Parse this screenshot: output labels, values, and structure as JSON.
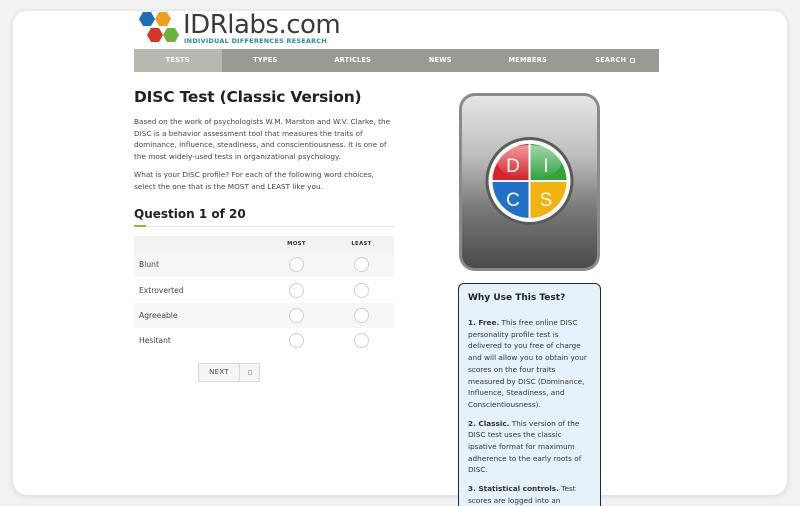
{
  "logo": {
    "word": "IDRlabs.com",
    "tagline": "INDIVIDUAL DIFFERENCES RESEARCH",
    "hex_colors": [
      "#1f6fb5",
      "#f0a020",
      "#d8342a",
      "#6ab23c"
    ]
  },
  "nav": {
    "items": [
      {
        "label": "TESTS",
        "active": true
      },
      {
        "label": "TYPES"
      },
      {
        "label": "ARTICLES"
      },
      {
        "label": "NEWS"
      },
      {
        "label": "MEMBERS"
      },
      {
        "label": "SEARCH",
        "icon": "search-icon"
      }
    ]
  },
  "page": {
    "title": "DISC Test (Classic Version)",
    "intro_1": "Based on the work of psychologists W.M. Marston and W.V. Clarke, the DISC is a behavior assessment tool that measures the traits of dominance, influence, steadiness, and conscientiousness. It is one of the most widely-used tests in organizational psychology.",
    "intro_2": "What is your DISC profile? For each of the following word choices, select the one that is the MOST and LEAST like you."
  },
  "question": {
    "title": "Question 1 of 20",
    "col_most": "MOST",
    "col_least": "LEAST",
    "rows": [
      "Blunt",
      "Extroverted",
      "Agreeable",
      "Hesitant"
    ],
    "next_label": "NEXT"
  },
  "disc_icon": {
    "letters": [
      "D",
      "I",
      "C",
      "S"
    ],
    "colors": {
      "D": "#d8232a",
      "I": "#33a341",
      "C": "#1f72c8",
      "S": "#f2b30f"
    }
  },
  "why": {
    "title": "Why Use This Test?",
    "points": [
      {
        "bold": "1. Free.",
        "text": " This free online DISC personality profile test is delivered to you free of charge and will allow you to obtain your scores on the four traits measured by DISC (Dominance, Influence, Steadiness, and Conscientiousness)."
      },
      {
        "bold": "2. Classic.",
        "text": " This version of the DISC test uses the classic ipsative format for maximum adherence to the early roots of DISC."
      },
      {
        "bold": "3. Statistical controls.",
        "text": " Test scores are logged into an"
      }
    ]
  }
}
